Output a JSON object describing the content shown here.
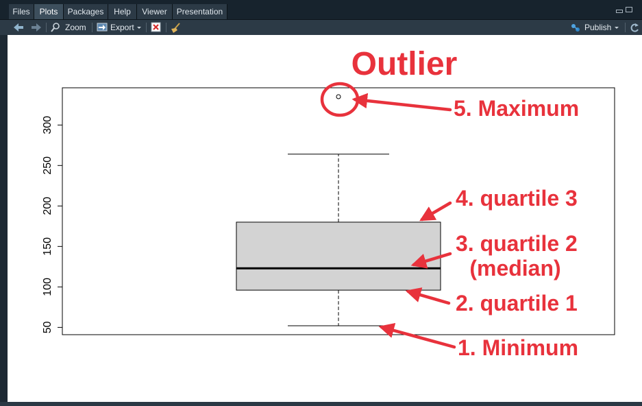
{
  "tabs": [
    {
      "label": "Files"
    },
    {
      "label": "Plots"
    },
    {
      "label": "Packages"
    },
    {
      "label": "Help"
    },
    {
      "label": "Viewer"
    },
    {
      "label": "Presentation"
    }
  ],
  "active_tab": "Plots",
  "toolbar": {
    "zoom_label": "Zoom",
    "export_label": "Export",
    "publish_label": "Publish"
  },
  "icons": {
    "back": "arrow-left-icon",
    "forward": "arrow-right-icon",
    "zoom": "magnifier-icon",
    "export": "export-icon",
    "remove": "remove-plot-icon",
    "clear": "broom-icon",
    "publish": "publish-icon",
    "refresh": "refresh-icon"
  },
  "colors": {
    "box_fill": "#d3d3d3",
    "annotation_red": "#e8323c"
  },
  "chart_data": {
    "type": "box",
    "title": "",
    "xlabel": "",
    "ylabel": "",
    "y_ticks": [
      50,
      100,
      150,
      200,
      250,
      300
    ],
    "ylim": [
      41,
      346
    ],
    "box": {
      "min": 52,
      "q1": 96,
      "median": 123,
      "q3": 180,
      "max": 264,
      "outliers": [
        335
      ]
    }
  },
  "annotations": {
    "outlier": "Outlier",
    "maximum": "5. Maximum",
    "quartile3": "4. quartile 3",
    "quartile2": "3. quartile 2",
    "median": "(median)",
    "quartile1": "2. quartile 1",
    "minimum": "1. Minimum"
  }
}
